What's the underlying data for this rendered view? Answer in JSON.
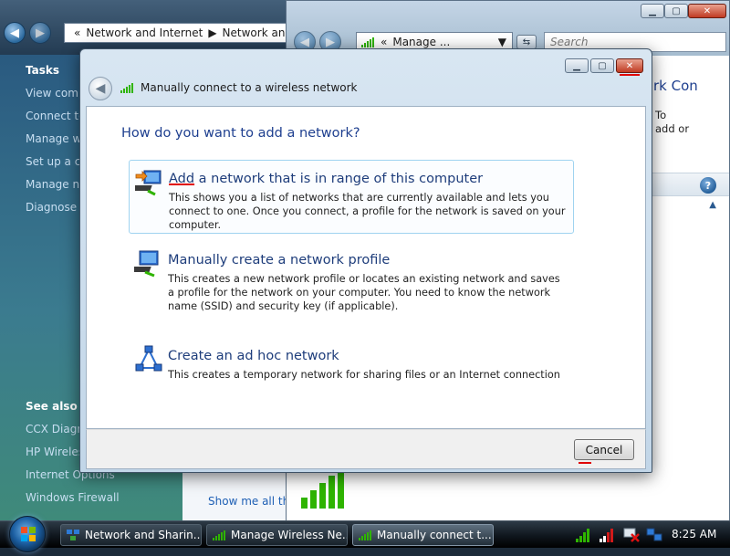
{
  "background_window": {
    "breadcrumb": [
      "«",
      "Network and Internet",
      "Network and"
    ],
    "left_pane": {
      "tasks_heading": "Tasks",
      "tasks": [
        "View comp",
        "Connect to",
        "Manage wi",
        "Set up a co",
        "Manage ne",
        "Diagnose a"
      ],
      "see_also_heading": "See also",
      "see_also": [
        "CCX Diagn",
        "HP Wireles",
        "Internet Options",
        "Windows Firewall"
      ]
    },
    "content_link": "Show me all th"
  },
  "manage_wireless_window": {
    "breadcrumb": [
      "«",
      "Manage ..."
    ],
    "search_placeholder": "Search",
    "snippets": [
      "rk Con",
      "To",
      "add or"
    ]
  },
  "dialog": {
    "title": "Manually connect to a wireless network",
    "heading": "How do you want to add a network?",
    "options": [
      {
        "accel": "Add",
        "title_rest": " a network that is in range of this computer",
        "description": "This shows you a list of networks that are currently available and lets you connect to one. Once you connect, a profile for the network is saved on your computer.",
        "icon": "network-add-arrow-icon"
      },
      {
        "title": "Manually create a network profile",
        "description": "This creates a new network profile or locates an existing network and saves a profile for the network on your computer. You need to know the network name (SSID) and security key (if applicable).",
        "icon": "network-profile-icon"
      },
      {
        "title": "Create an ad hoc network",
        "description": "This creates a temporary network for sharing files or an Internet connection",
        "icon": "ad-hoc-network-icon"
      }
    ],
    "cancel_label": "Cancel"
  },
  "taskbar": {
    "items": [
      {
        "label": "Network and Sharin...",
        "icon": "network-center-icon"
      },
      {
        "label": "Manage Wireless Ne...",
        "icon": "wireless-signal-icon"
      },
      {
        "label": "Manually connect t...",
        "icon": "wireless-signal-icon"
      }
    ],
    "clock": "8:25 AM"
  },
  "colors": {
    "heading_blue": "#1e3f8f",
    "accelerator_red": "#e00000",
    "signal_green": "#2fb400"
  }
}
